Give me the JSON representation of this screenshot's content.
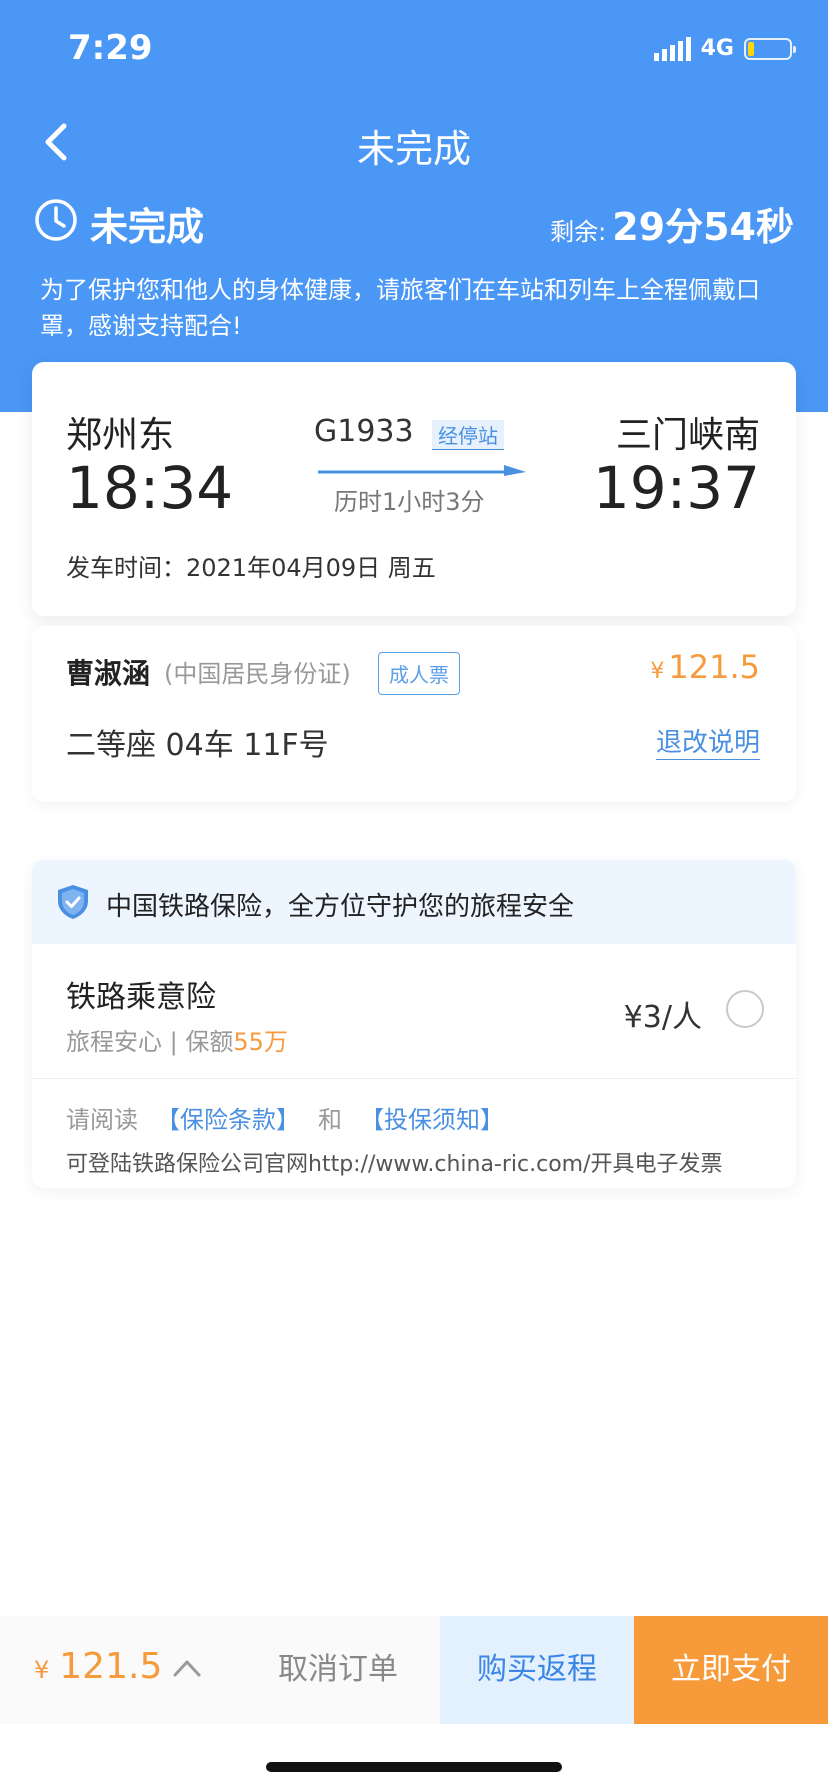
{
  "status_bar": {
    "time": "7:29",
    "network": "4G",
    "battery_level": 0.15
  },
  "nav": {
    "title": "未完成",
    "back_icon": "chevron-left-icon"
  },
  "order_status": {
    "icon": "clock-icon",
    "text": "未完成",
    "remaining_label": "剩余:",
    "remaining_time": "29分54秒"
  },
  "notice": "为了保护您和他人的身体健康，请旅客们在车站和列车上全程佩戴口罩，感谢支持配合!",
  "train": {
    "from_station": "郑州东",
    "from_time": "18:34",
    "train_no": "G1933",
    "stops_label": "经停站",
    "duration": "历时1小时3分",
    "to_station": "三门峡南",
    "to_time": "19:37",
    "departure_date": "发车时间：2021年04月09日 周五"
  },
  "passenger": {
    "name": "曹淑涵",
    "id_type": "(中国居民身份证)",
    "ticket_type": "成人票",
    "price_symbol": "¥",
    "price": "121.5",
    "seat": "二等座 04车 11F号",
    "refund_link": "退改说明"
  },
  "insurance": {
    "banner": "中国铁路保险，全方位守护您的旅程安全",
    "product_name": "铁路乘意险",
    "subtitle_prefix": "旅程安心 | 保额",
    "coverage": "55万",
    "price": "¥3/人",
    "selected": false,
    "read_prefix": "请阅读",
    "terms_link": "【保险条款】",
    "and_text": "和",
    "notice_link": "【投保须知】",
    "invoice_text": "可登陆铁路保险公司官网http://www.china-ric.com/开具电子发票"
  },
  "bottom_bar": {
    "price_symbol": "¥",
    "total": "121.5",
    "cancel_label": "取消订单",
    "return_label": "购买返程",
    "pay_label": "立即支付"
  },
  "colors": {
    "header_blue": "#4a97f5",
    "price_orange": "#f59b3e",
    "link_blue": "#4a90e2",
    "pay_orange": "#f79a3a",
    "return_bg": "#e3f0fd"
  }
}
